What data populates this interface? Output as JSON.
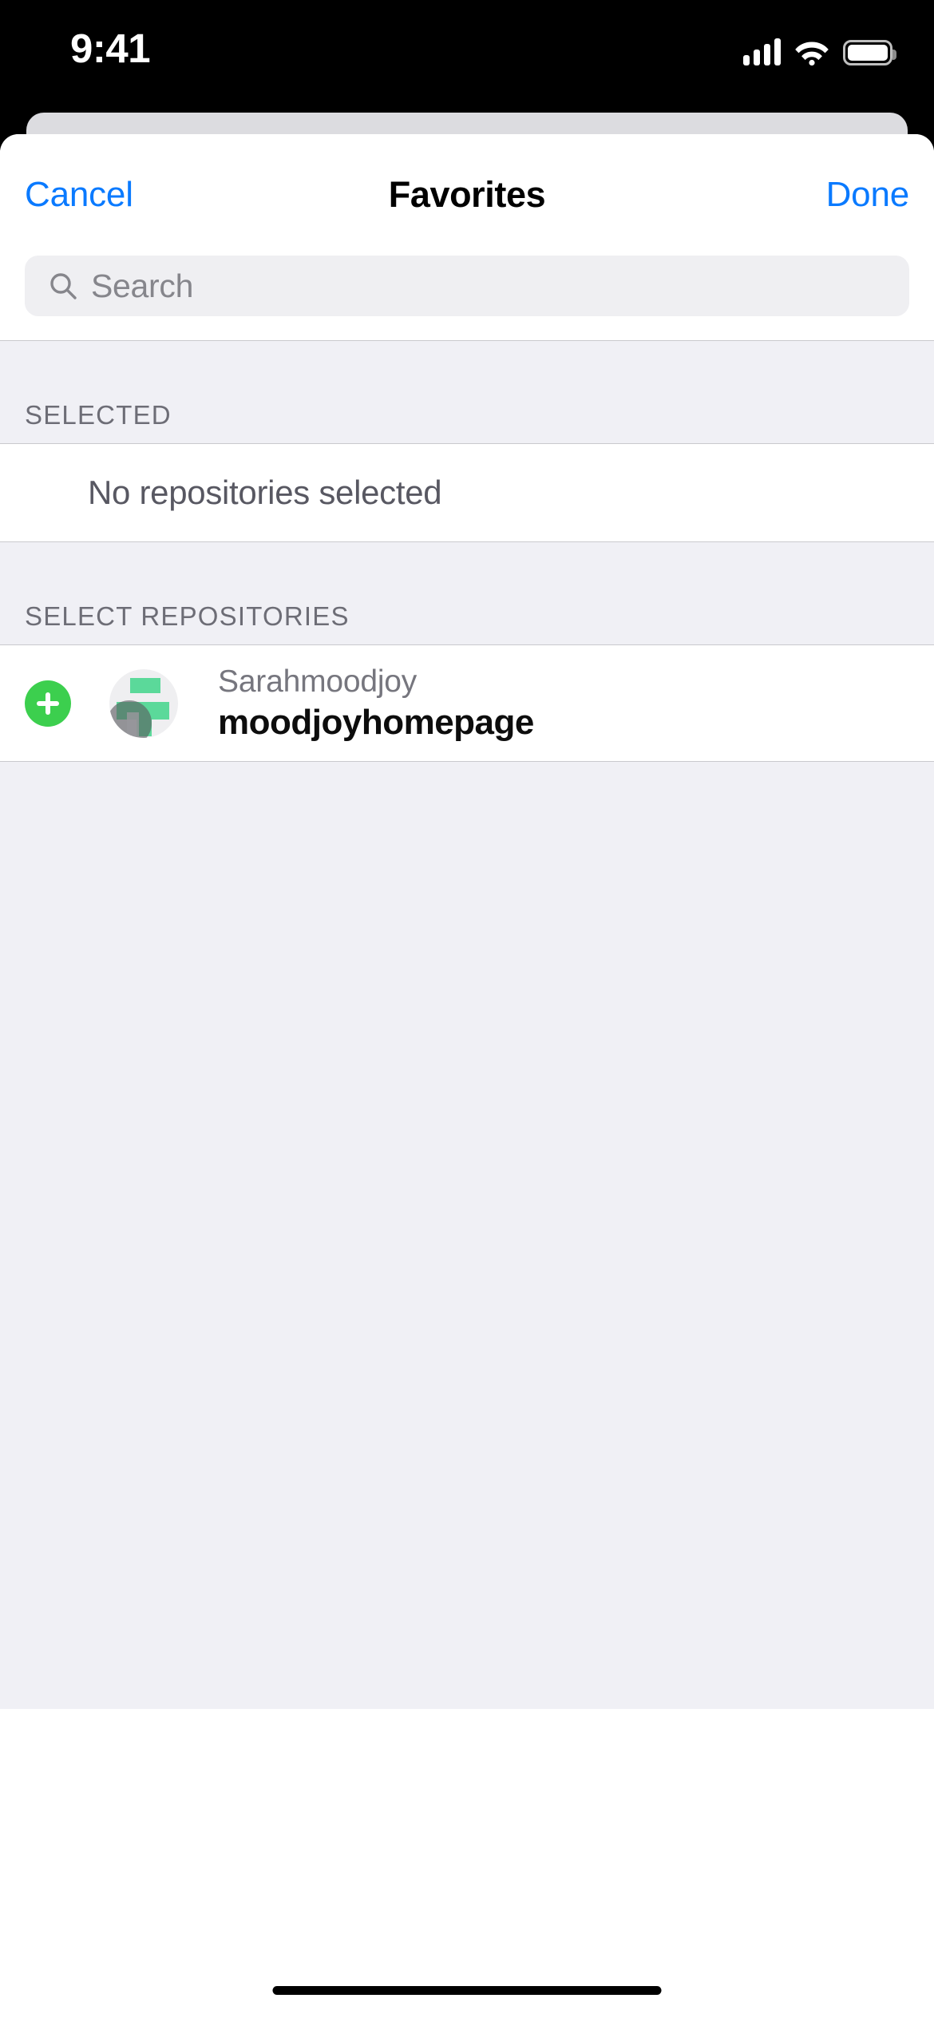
{
  "status_bar": {
    "time": "9:41",
    "signal_icon": "cellular-bars-icon",
    "wifi_icon": "wifi-icon",
    "battery_icon": "battery-full-icon"
  },
  "sheet": {
    "nav": {
      "cancel_label": "Cancel",
      "title": "Favorites",
      "done_label": "Done"
    },
    "search": {
      "placeholder": "Search",
      "value": "",
      "icon": "search-icon"
    },
    "sections": [
      {
        "header": "SELECTED",
        "empty_message": "No repositories selected"
      },
      {
        "header": "SELECT REPOSITORIES",
        "rows": [
          {
            "add_icon": "plus-circle-icon",
            "avatar_icon": "repository-avatar-icon",
            "owner": "Sarahmoodjoy",
            "name": "moodjoyhomepage"
          }
        ]
      }
    ]
  },
  "home_indicator": "home-indicator",
  "colors": {
    "accent_blue": "#0a7aff",
    "add_green": "#3ccf4e",
    "avatar_green": "#5bd99a",
    "group_background": "#f0f0f5",
    "search_background": "#efeff2",
    "separator": "#c9c9cd",
    "secondary_text": "#6d6d76",
    "sheet_background": "#ffffff",
    "back_card": "#dcdce0"
  }
}
